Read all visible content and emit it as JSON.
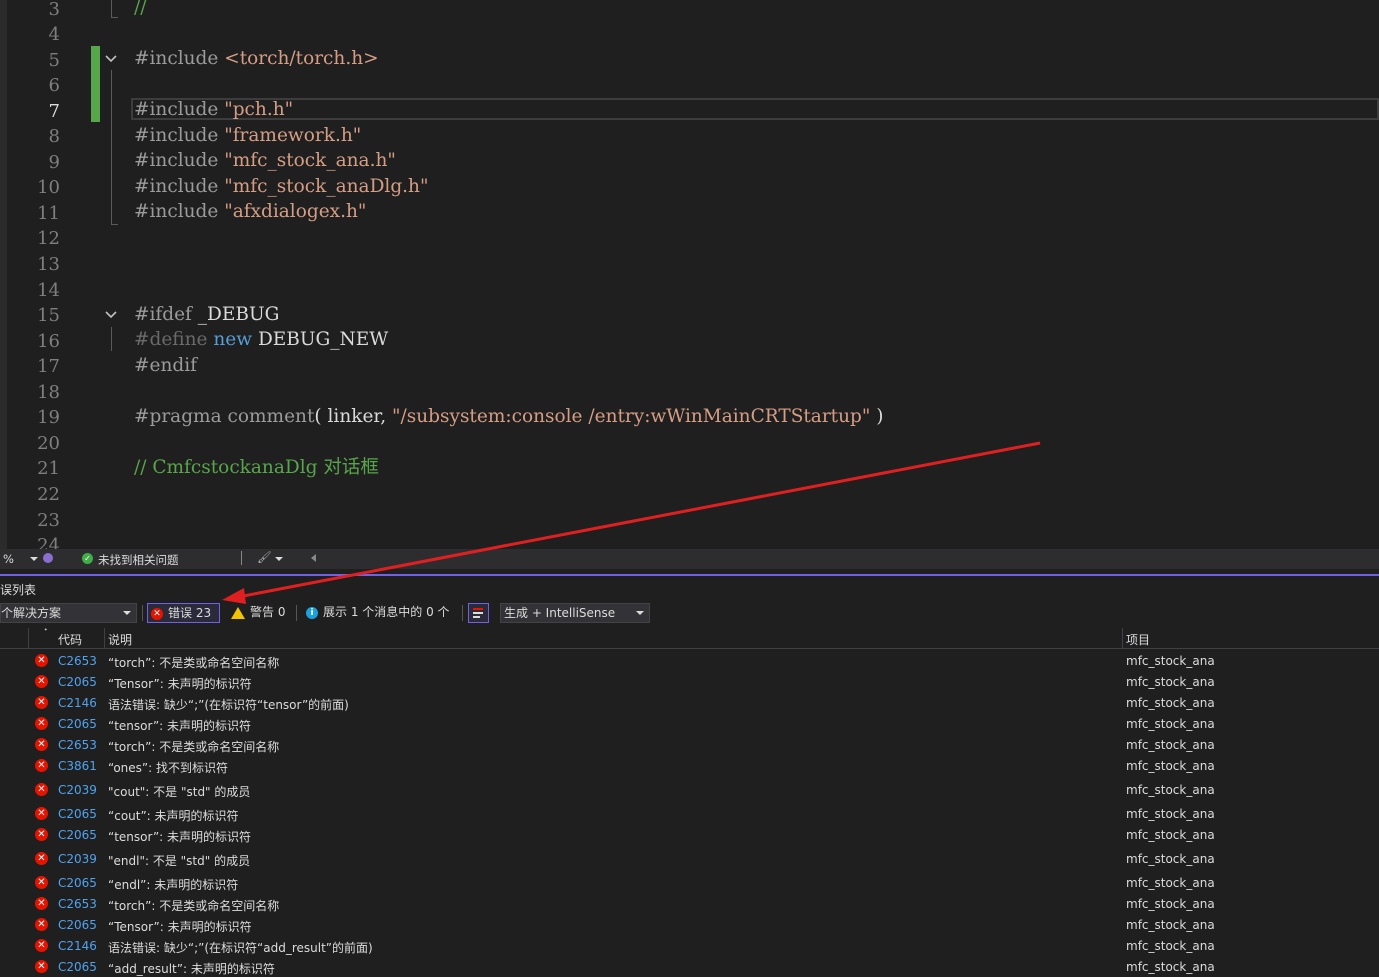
{
  "editor": {
    "line_numbers": [
      "3",
      "4",
      "5",
      "6",
      "7",
      "8",
      "9",
      "10",
      "11",
      "12",
      "13",
      "14",
      "15",
      "16",
      "17",
      "18",
      "19",
      "20",
      "21",
      "22",
      "23",
      "24"
    ],
    "lines": {
      "l3_comment": "//",
      "l5_directive": "#include ",
      "l5_path": "<torch/torch.h>",
      "l7_directive": "#include ",
      "l7_path": "\"pch.h\"",
      "l8_directive": "#include ",
      "l8_path": "\"framework.h\"",
      "l9_directive": "#include ",
      "l9_path": "\"mfc_stock_ana.h\"",
      "l10_directive": "#include ",
      "l10_path": "\"mfc_stock_anaDlg.h\"",
      "l11_directive": "#include ",
      "l11_path": "\"afxdialogex.h\"",
      "l15_directive": "#ifdef ",
      "l15_symbol": "_DEBUG",
      "l16_directive": "#define ",
      "l16_kw": "new",
      "l16_symbol": " DEBUG_NEW",
      "l17_directive": "#endif",
      "l19_directive": "#pragma ",
      "l19_a": "comment",
      "l19_b": "( ",
      "l19_c": "linker",
      "l19_d": ", ",
      "l19_str": "\"/subsystem:console /entry:wWinMainCRTStartup\"",
      "l19_e": " )",
      "l21_comment": "// CmfcstockanaDlg 对话框"
    }
  },
  "status": {
    "zoom": "%",
    "issues": "未找到相关问题"
  },
  "panel": {
    "title": "误列表",
    "scope": "个解决方案",
    "errors_label": "错误 23",
    "warnings_label": "警告 0",
    "messages_label": "展示 1 个消息中的 0 个",
    "build_filter": "生成 + IntelliSense",
    "columns": {
      "code": "代码",
      "desc": "说明",
      "project": "项目"
    }
  },
  "errors": [
    {
      "code": "C2653",
      "desc": "“torch”: 不是类或命名空间名称",
      "project": "mfc_stock_ana"
    },
    {
      "code": "C2065",
      "desc": "“Tensor”: 未声明的标识符",
      "project": "mfc_stock_ana"
    },
    {
      "code": "C2146",
      "desc": "语法错误: 缺少“;”(在标识符“tensor”的前面)",
      "project": "mfc_stock_ana"
    },
    {
      "code": "C2065",
      "desc": "“tensor”: 未声明的标识符",
      "project": "mfc_stock_ana"
    },
    {
      "code": "C2653",
      "desc": "“torch”: 不是类或命名空间名称",
      "project": "mfc_stock_ana"
    },
    {
      "code": "C3861",
      "desc": "“ones”: 找不到标识符",
      "project": "mfc_stock_ana"
    },
    {
      "code": "C2039",
      "desc": "\"cout\": 不是 \"std\" 的成员",
      "project": "mfc_stock_ana"
    },
    {
      "code": "C2065",
      "desc": "“cout”: 未声明的标识符",
      "project": "mfc_stock_ana"
    },
    {
      "code": "C2065",
      "desc": "“tensor”: 未声明的标识符",
      "project": "mfc_stock_ana"
    },
    {
      "code": "C2039",
      "desc": "\"endl\": 不是 \"std\" 的成员",
      "project": "mfc_stock_ana"
    },
    {
      "code": "C2065",
      "desc": "“endl”: 未声明的标识符",
      "project": "mfc_stock_ana"
    },
    {
      "code": "C2653",
      "desc": "“torch”: 不是类或命名空间名称",
      "project": "mfc_stock_ana"
    },
    {
      "code": "C2065",
      "desc": "“Tensor”: 未声明的标识符",
      "project": "mfc_stock_ana"
    },
    {
      "code": "C2146",
      "desc": "语法错误: 缺少“;”(在标识符“add_result”的前面)",
      "project": "mfc_stock_ana"
    },
    {
      "code": "C2065",
      "desc": "“add_result”: 未声明的标识符",
      "project": "mfc_stock_ana"
    }
  ],
  "colors": {
    "accent": "#7160e8",
    "error": "#e51400",
    "annotation_arrow": "#e02020"
  }
}
